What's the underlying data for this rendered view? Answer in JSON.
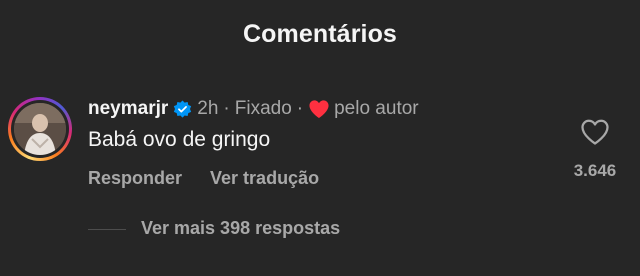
{
  "header": {
    "title": "Comentários"
  },
  "comment": {
    "username": "neymarjr",
    "verified_icon": "verified-badge-icon",
    "time": "2h",
    "separator": "·",
    "pinned_label": "Fixado",
    "heart_icon": "red-heart-icon",
    "liked_by_author_label": "pelo autor",
    "text": "Babá ovo de gringo",
    "like_icon": "heart-outline-icon",
    "like_count": "3.646",
    "reply_label": "Responder",
    "translate_label": "Ver tradução",
    "view_replies_label": "Ver mais 398 respostas"
  },
  "colors": {
    "background": "#262626",
    "text_primary": "#f5f5f5",
    "text_secondary": "#a8a8a8",
    "verified_blue": "#0095f6",
    "heart_red": "#ff3040"
  }
}
